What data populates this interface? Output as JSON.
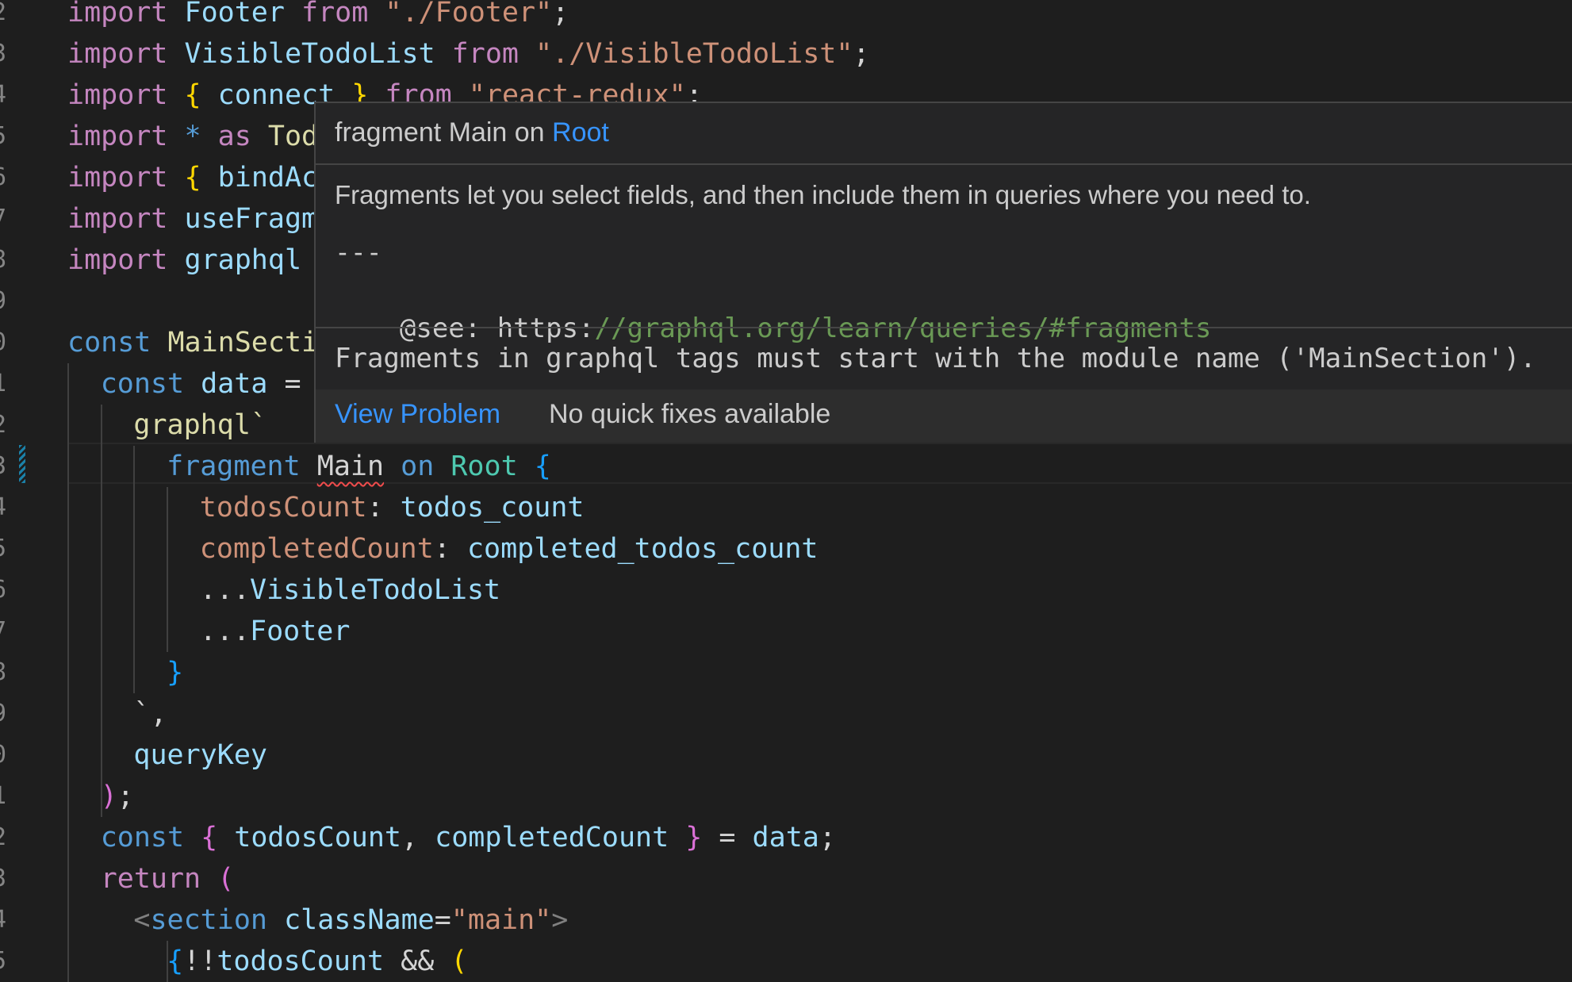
{
  "gutter": {
    "line_numbers": [
      "2",
      "3",
      "4",
      "5",
      "6",
      "7",
      "8",
      "9",
      "0",
      "1",
      "2",
      "3",
      "4",
      "5",
      "6",
      "7",
      "8",
      "9",
      "0",
      "1",
      "2",
      "3",
      "4",
      "5"
    ]
  },
  "code_lines": [
    [
      {
        "t": "import",
        "c": "kwc"
      },
      {
        "t": " "
      },
      {
        "t": "Footer",
        "c": "id"
      },
      {
        "t": " "
      },
      {
        "t": "from",
        "c": "kwc"
      },
      {
        "t": " "
      },
      {
        "t": "\"./Footer\"",
        "c": "str"
      },
      {
        "t": ";",
        "c": "pl"
      }
    ],
    [
      {
        "t": "import",
        "c": "kwc"
      },
      {
        "t": " "
      },
      {
        "t": "VisibleTodoList",
        "c": "id"
      },
      {
        "t": " "
      },
      {
        "t": "from",
        "c": "kwc"
      },
      {
        "t": " "
      },
      {
        "t": "\"./VisibleTodoList\"",
        "c": "str"
      },
      {
        "t": ";",
        "c": "pl"
      }
    ],
    [
      {
        "t": "import",
        "c": "kwc"
      },
      {
        "t": " "
      },
      {
        "t": "{",
        "c": "br1"
      },
      {
        "t": " "
      },
      {
        "t": "connect",
        "c": "id"
      },
      {
        "t": " "
      },
      {
        "t": "}",
        "c": "br1"
      },
      {
        "t": " "
      },
      {
        "t": "from",
        "c": "kwc"
      },
      {
        "t": " "
      },
      {
        "t": "\"react-redux\"",
        "c": "str"
      },
      {
        "t": ";",
        "c": "pl"
      }
    ],
    [
      {
        "t": "import",
        "c": "kwc"
      },
      {
        "t": " "
      },
      {
        "t": "*",
        "c": "kw"
      },
      {
        "t": " "
      },
      {
        "t": "as",
        "c": "kwc"
      },
      {
        "t": " "
      },
      {
        "t": "Tod",
        "c": "fn"
      }
    ],
    [
      {
        "t": "import",
        "c": "kwc"
      },
      {
        "t": " "
      },
      {
        "t": "{",
        "c": "br1"
      },
      {
        "t": " "
      },
      {
        "t": "bindAc",
        "c": "id"
      }
    ],
    [
      {
        "t": "import",
        "c": "kwc"
      },
      {
        "t": " "
      },
      {
        "t": "useFragm",
        "c": "id"
      }
    ],
    [
      {
        "t": "import",
        "c": "kwc"
      },
      {
        "t": " "
      },
      {
        "t": "graphql",
        "c": "id"
      }
    ],
    [],
    [
      {
        "t": "const",
        "c": "kw"
      },
      {
        "t": " "
      },
      {
        "t": "MainSecti",
        "c": "fn"
      }
    ],
    [
      {
        "t": "const",
        "c": "kw"
      },
      {
        "t": " "
      },
      {
        "t": "data",
        "c": "id"
      },
      {
        "t": " "
      },
      {
        "t": "=",
        "c": "pl"
      }
    ],
    [
      {
        "t": "graphql`",
        "c": "fn"
      }
    ],
    [
      {
        "t": "fragment",
        "c": "kw"
      },
      {
        "t": " "
      },
      {
        "t": "Main",
        "c": "pl",
        "sq": true
      },
      {
        "t": " "
      },
      {
        "t": "on",
        "c": "kw"
      },
      {
        "t": " "
      },
      {
        "t": "Root",
        "c": "ty"
      },
      {
        "t": " "
      },
      {
        "t": "{",
        "c": "br3"
      }
    ],
    [
      {
        "t": "todosCount",
        "c": "str"
      },
      {
        "t": ": ",
        "c": "pl"
      },
      {
        "t": "todos_count",
        "c": "id"
      }
    ],
    [
      {
        "t": "completedCount",
        "c": "str"
      },
      {
        "t": ": ",
        "c": "pl"
      },
      {
        "t": "completed_todos_count",
        "c": "id"
      }
    ],
    [
      {
        "t": "...",
        "c": "pl"
      },
      {
        "t": "VisibleTodoList",
        "c": "id"
      }
    ],
    [
      {
        "t": "...",
        "c": "pl"
      },
      {
        "t": "Footer",
        "c": "id"
      }
    ],
    [
      {
        "t": "}",
        "c": "br3"
      }
    ],
    [
      {
        "t": "`,",
        "c": "pl"
      }
    ],
    [
      {
        "t": "queryKey",
        "c": "id"
      }
    ],
    [
      {
        "t": ")",
        "c": "br2"
      },
      {
        "t": ";",
        "c": "pl"
      }
    ],
    [
      {
        "t": "const",
        "c": "kw"
      },
      {
        "t": " "
      },
      {
        "t": "{",
        "c": "br2"
      },
      {
        "t": " "
      },
      {
        "t": "todosCount",
        "c": "id"
      },
      {
        "t": ", ",
        "c": "pl"
      },
      {
        "t": "completedCount",
        "c": "id"
      },
      {
        "t": " "
      },
      {
        "t": "}",
        "c": "br2"
      },
      {
        "t": " = ",
        "c": "pl"
      },
      {
        "t": "data",
        "c": "id"
      },
      {
        "t": ";",
        "c": "pl"
      }
    ],
    [
      {
        "t": "return",
        "c": "kwc"
      },
      {
        "t": " "
      },
      {
        "t": "(",
        "c": "br2"
      }
    ],
    [
      {
        "t": "<",
        "c": "tag"
      },
      {
        "t": "section",
        "c": "kw"
      },
      {
        "t": " "
      },
      {
        "t": "className",
        "c": "id"
      },
      {
        "t": "=",
        "c": "pl"
      },
      {
        "t": "\"main\"",
        "c": "str"
      },
      {
        "t": ">",
        "c": "tag"
      }
    ],
    [
      {
        "t": "{",
        "c": "br3"
      },
      {
        "t": "!!",
        "c": "pl"
      },
      {
        "t": "todosCount",
        "c": "id"
      },
      {
        "t": " && ",
        "c": "pl"
      },
      {
        "t": "(",
        "c": "br1"
      }
    ]
  ],
  "hover": {
    "signature_prefix": "fragment Main on ",
    "signature_type": "Root",
    "description": "Fragments let you select fields, and then include them in queries where you need to.",
    "rule": "---",
    "see_label": "@see: https:",
    "see_path": "//graphql.org/learn/queries/#fragments",
    "problem": "Fragments in graphql tags must start with the module name ('MainSection').",
    "view_problem": "View Problem",
    "no_fixes": "No quick fixes available"
  },
  "colors": {
    "background": "#1e1e1e",
    "hover_background": "#252526",
    "link": "#3794ff",
    "error_squiggle": "#f14c4c"
  }
}
